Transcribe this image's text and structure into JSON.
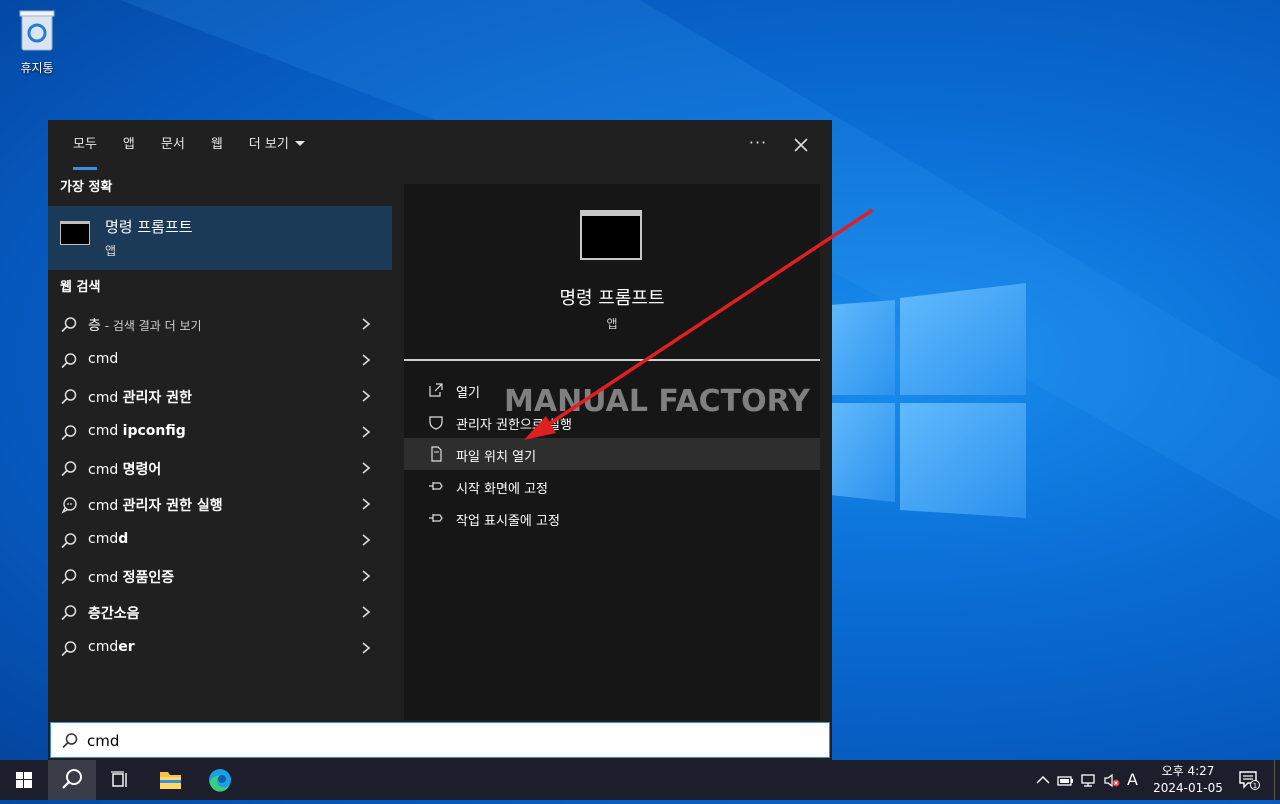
{
  "desktop": {
    "recycle_bin_label": "휴지통"
  },
  "search_panel": {
    "tabs": [
      {
        "label": "모두"
      },
      {
        "label": "앱"
      },
      {
        "label": "문서"
      },
      {
        "label": "웹"
      },
      {
        "label": "더 보기"
      }
    ],
    "more_options_label": "···",
    "best_match_heading": "가장 정확",
    "best_match": {
      "title": "명령 프롬프트",
      "subtitle": "앱"
    },
    "web_search_heading": "웹 검색",
    "web_results": [
      {
        "prefix": "층",
        "bold": "",
        "suffix": " - 검색 결과 더 보기",
        "icon": "search-icon"
      },
      {
        "prefix": "cmd",
        "bold": "",
        "suffix": "",
        "icon": "search-icon"
      },
      {
        "prefix": "cmd ",
        "bold": "관리자 권한",
        "suffix": "",
        "icon": "search-icon"
      },
      {
        "prefix": "cmd ",
        "bold": "ipconfig",
        "suffix": "",
        "icon": "search-icon"
      },
      {
        "prefix": "cmd ",
        "bold": "명령어",
        "suffix": "",
        "icon": "search-icon"
      },
      {
        "prefix": "cmd ",
        "bold": "관리자 권한 실행",
        "suffix": "",
        "icon": "chat-icon"
      },
      {
        "prefix": "cmd",
        "bold": "d",
        "suffix": "",
        "icon": "search-icon"
      },
      {
        "prefix": "cmd ",
        "bold": "정품인증",
        "suffix": "",
        "icon": "search-icon"
      },
      {
        "prefix": "",
        "bold": "층간소음",
        "suffix": "",
        "icon": "search-icon"
      },
      {
        "prefix": "cmd",
        "bold": "er",
        "suffix": "",
        "icon": "search-icon"
      }
    ],
    "preview": {
      "title": "명령 프롬프트",
      "subtitle": "앱",
      "actions": [
        {
          "label": "열기",
          "icon": "open-icon"
        },
        {
          "label": "관리자 권한으로 실행",
          "icon": "shield-icon"
        },
        {
          "label": "파일 위치 열기",
          "icon": "folder-icon"
        },
        {
          "label": "시작 화면에 고정",
          "icon": "pin-icon"
        },
        {
          "label": "작업 표시줄에 고정",
          "icon": "pin-icon"
        }
      ],
      "highlighted_action": "파일 위치 열기"
    },
    "watermark": "MANUAL FACTORY",
    "search_box": {
      "value": "cmd"
    }
  },
  "taskbar": {
    "ime_label": "A",
    "clock": {
      "time": "오후 4:27",
      "date": "2024-01-05"
    },
    "notification_count": "1"
  },
  "colors": {
    "accent": "#3a8ee6",
    "selected_row": "#1b3a57",
    "arrow": "#e02020"
  }
}
